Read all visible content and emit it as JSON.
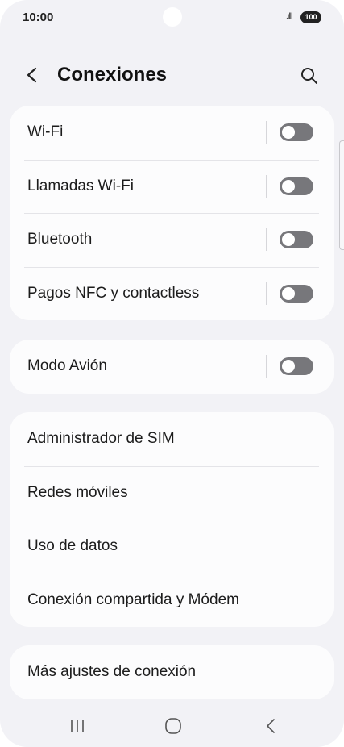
{
  "status_bar": {
    "time": "10:00",
    "signal": ".ıll",
    "battery": "100"
  },
  "header": {
    "title": "Conexiones"
  },
  "icons": {
    "back": "chevron-left-icon",
    "search": "search-icon",
    "nav_recents": "recents-icon",
    "nav_home": "home-icon",
    "nav_back": "back-icon"
  },
  "groups": [
    {
      "items": [
        {
          "label": "Wi-Fi",
          "toggle": "off"
        },
        {
          "label": "Llamadas Wi-Fi",
          "toggle": "off"
        },
        {
          "label": "Bluetooth",
          "toggle": "off"
        },
        {
          "label": "Pagos NFC y contactless",
          "toggle": "off"
        }
      ]
    },
    {
      "items": [
        {
          "label": "Modo Avión",
          "toggle": "off"
        }
      ]
    },
    {
      "items": [
        {
          "label": "Administrador de SIM"
        },
        {
          "label": "Redes móviles"
        },
        {
          "label": "Uso de datos"
        },
        {
          "label": "Conexión compartida y Módem"
        }
      ]
    },
    {
      "items": [
        {
          "label": "Más ajustes de conexión"
        }
      ]
    }
  ],
  "colors": {
    "background": "#f2f2f6",
    "card": "#fcfcfd",
    "toggle_off": "#77777b"
  }
}
